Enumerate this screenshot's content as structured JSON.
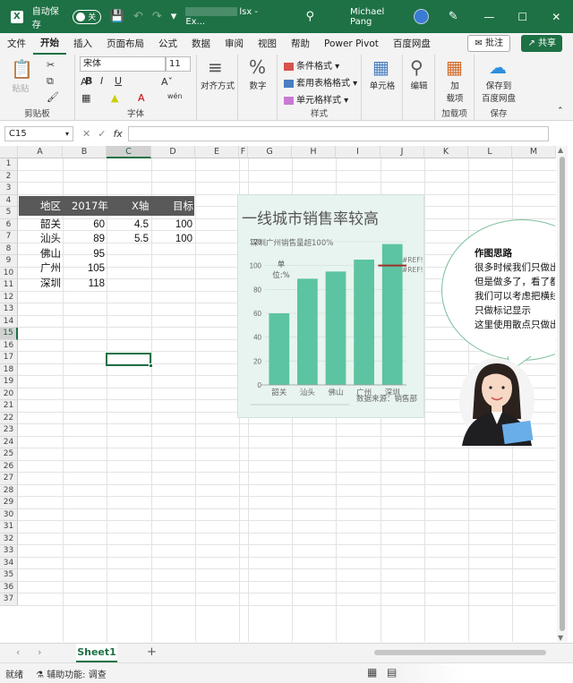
{
  "titlebar": {
    "autosave_label": "自动保存",
    "autosave_state": "关",
    "filename": "lsx - Ex...",
    "username": "Michael Pang"
  },
  "tabs": [
    "文件",
    "开始",
    "插入",
    "页面布局",
    "公式",
    "数据",
    "审阅",
    "视图",
    "帮助",
    "Power Pivot",
    "百度网盘"
  ],
  "active_tab": "开始",
  "comment_label": "批注",
  "share_label": "共享",
  "ribbon": {
    "paste": "粘贴",
    "clipboard": "剪贴板",
    "font_name": "宋体",
    "font_size": "11",
    "font_group": "字体",
    "bold": "B",
    "italic": "I",
    "underline": "U",
    "wen": "wén",
    "align": "对齐方式",
    "number": "数字",
    "cond_format": "条件格式",
    "table_format": "套用表格格式",
    "cell_style": "单元格样式",
    "styles": "样式",
    "cells": "单元格",
    "editing": "编辑",
    "addin_btn": "加\n载项",
    "addin_group": "加载项",
    "save_baidu": "保存到\n百度网盘",
    "save_group": "保存"
  },
  "formula_bar": {
    "name_box": "C15",
    "fx": "fx",
    "content": ""
  },
  "columns": [
    "A",
    "B",
    "C",
    "D",
    "E",
    "F",
    "G",
    "H",
    "I",
    "J",
    "K",
    "L",
    "M"
  ],
  "selected_column": "C",
  "rows": [
    "1",
    "2",
    "3",
    "4",
    "5",
    "6",
    "7",
    "8",
    "9",
    "10",
    "11",
    "12",
    "13",
    "14",
    "15",
    "16",
    "17",
    "18",
    "19",
    "20",
    "21",
    "22",
    "23",
    "24",
    "25",
    "26",
    "27",
    "28",
    "29",
    "30",
    "31",
    "32",
    "33",
    "34",
    "35",
    "36",
    "37"
  ],
  "selected_row": "15",
  "table": {
    "headers": [
      "地区",
      "2017年",
      "X轴",
      "目标"
    ],
    "rows": [
      {
        "region": "韶关",
        "value": "60",
        "x": "4.5",
        "target": "100"
      },
      {
        "region": "汕头",
        "value": "89",
        "x": "5.5",
        "target": "100"
      },
      {
        "region": "佛山",
        "value": "95",
        "x": "",
        "target": ""
      },
      {
        "region": "广州",
        "value": "105",
        "x": "",
        "target": ""
      },
      {
        "region": "深圳",
        "value": "118",
        "x": "",
        "target": ""
      }
    ]
  },
  "chart_data": {
    "type": "bar",
    "title": "一线城市销售率较高",
    "subtitle": "深圳广州销售量超100%",
    "categories": [
      "韶关",
      "汕头",
      "佛山",
      "广州",
      "深圳"
    ],
    "values": [
      60,
      89,
      95,
      105,
      118
    ],
    "target_line": {
      "value": 100,
      "x_range": [
        4.5,
        5.5
      ]
    },
    "ylim": [
      0,
      120
    ],
    "yticks": [
      0,
      20,
      40,
      60,
      80,
      100,
      120
    ],
    "unit_label": "单位:%",
    "source_label": "数据来源：销售部",
    "ref_labels": [
      "#REF!",
      "#REF!"
    ],
    "bar_color": "#5cc4a2",
    "target_color": "#a0302a",
    "background": "#e8f4ef"
  },
  "callout": {
    "title": "作图思路",
    "lines": [
      "很多时候我们只做出",
      "但是做多了，看了都",
      "我们可以考虑把横线",
      "只做标记显示",
      "这里使用散点只做出"
    ]
  },
  "sheet_tab": "Sheet1",
  "status": {
    "ready": "就绪",
    "accessibility": "辅助功能: 调查"
  },
  "colors": {
    "excel_green": "#1e7145",
    "header_row_bg": "#595959"
  }
}
